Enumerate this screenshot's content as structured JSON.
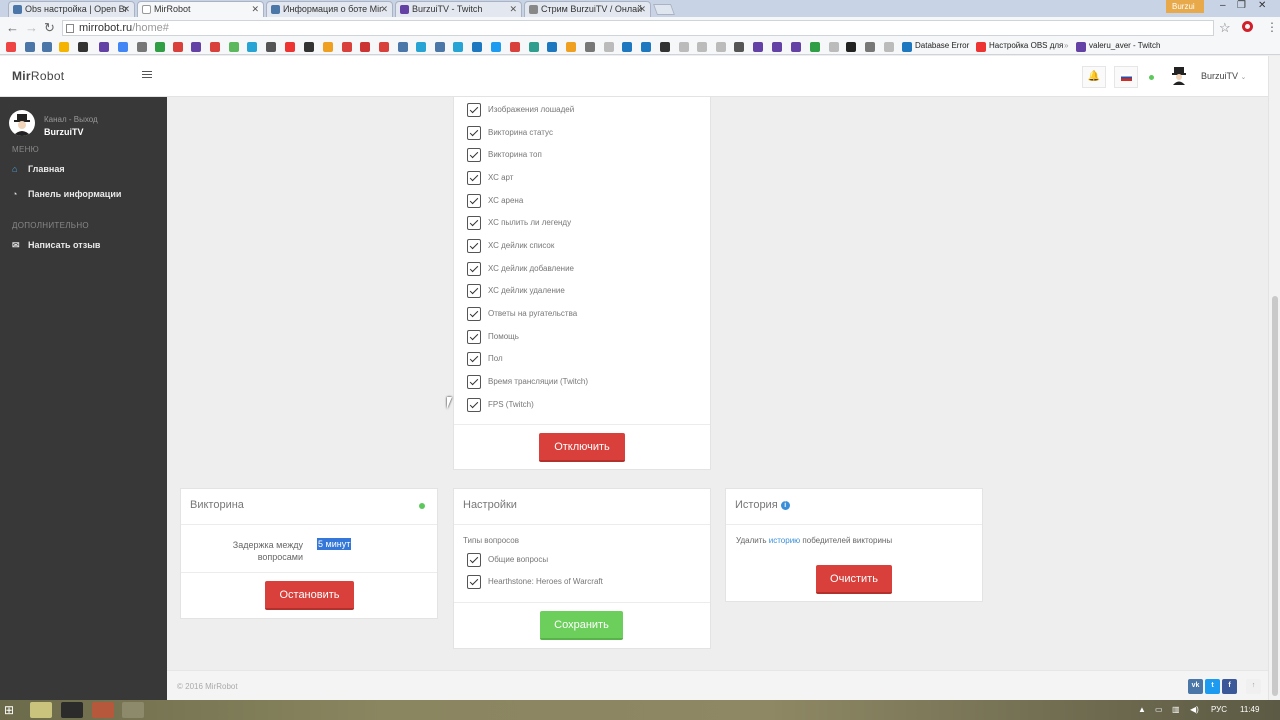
{
  "browser": {
    "tabs": [
      {
        "title": "Obs настройка | Open Br",
        "favicon_color": "#4a76a8",
        "active": false
      },
      {
        "title": "MirRobot",
        "favicon_color": "#ffffff",
        "active": true
      },
      {
        "title": "Информация о боте Mir",
        "favicon_color": "#4a76a8",
        "active": false
      },
      {
        "title": "BurzuiTV - Twitch",
        "favicon_color": "#6441a4",
        "active": false
      },
      {
        "title": "Стрим BurzuiTV / Онлай",
        "favicon_color": "#888888",
        "active": false
      }
    ],
    "user_badge": "Burzui",
    "url_host": "mirrobot.ru",
    "url_path": "/home#",
    "bookmarks": [
      {
        "label": "Database Error",
        "icon": "page-icon"
      },
      {
        "label": "Настройка OBS для",
        "icon": "youtube-icon"
      },
      {
        "label": "valeru_aver - Twitch",
        "icon": "twitch-icon"
      }
    ]
  },
  "app": {
    "brand_bold": "Mir",
    "brand_rest": "Robot",
    "nav_user": "BurzuiTV",
    "status_color": "#5cc85c"
  },
  "sidebar": {
    "channel_label": "Канал - Выход",
    "username": "BurzuiTV",
    "menu_heading": "МЕНЮ",
    "extra_heading": "ДОПОЛНИТЕЛЬНО",
    "items": [
      {
        "label": "Главная",
        "icon": "home-icon"
      },
      {
        "label": "Панель информации",
        "icon": "dashboard-icon"
      },
      {
        "label": "Написать отзыв",
        "icon": "mail-icon"
      }
    ]
  },
  "commands": {
    "items": [
      "Изображения лошадей",
      "Викторина статус",
      "Викторина топ",
      "ХС арт",
      "ХС арена",
      "ХС пылить ли легенду",
      "ХС дейлик список",
      "ХС дейлик добавление",
      "ХС дейлик удаление",
      "Ответы на ругательства",
      "Помощь",
      "Пол",
      "Время трансляции (Twitch)",
      "FPS (Twitch)"
    ],
    "disable_button": "Отключить"
  },
  "quiz": {
    "title": "Викторина",
    "delay_label_1": "Задержка между",
    "delay_label_2": "вопросами",
    "delay_value": "5 минут",
    "stop_button": "Остановить"
  },
  "settings": {
    "title": "Настройки",
    "types_label": "Типы вопросов",
    "types": [
      "Общие вопросы",
      "Hearthstone: Heroes of Warcraft"
    ],
    "save_button": "Сохранить"
  },
  "history": {
    "title": "История",
    "text_before": "Удалить ",
    "link_text": "историю",
    "text_after": " победителей викторины",
    "clear_button": "Очистить"
  },
  "footer": {
    "copyright": "© 2016 MirRobot",
    "social": [
      "VK",
      "Twitter",
      "Facebook"
    ]
  },
  "taskbar": {
    "lang": "РУС",
    "time": "11:49"
  }
}
